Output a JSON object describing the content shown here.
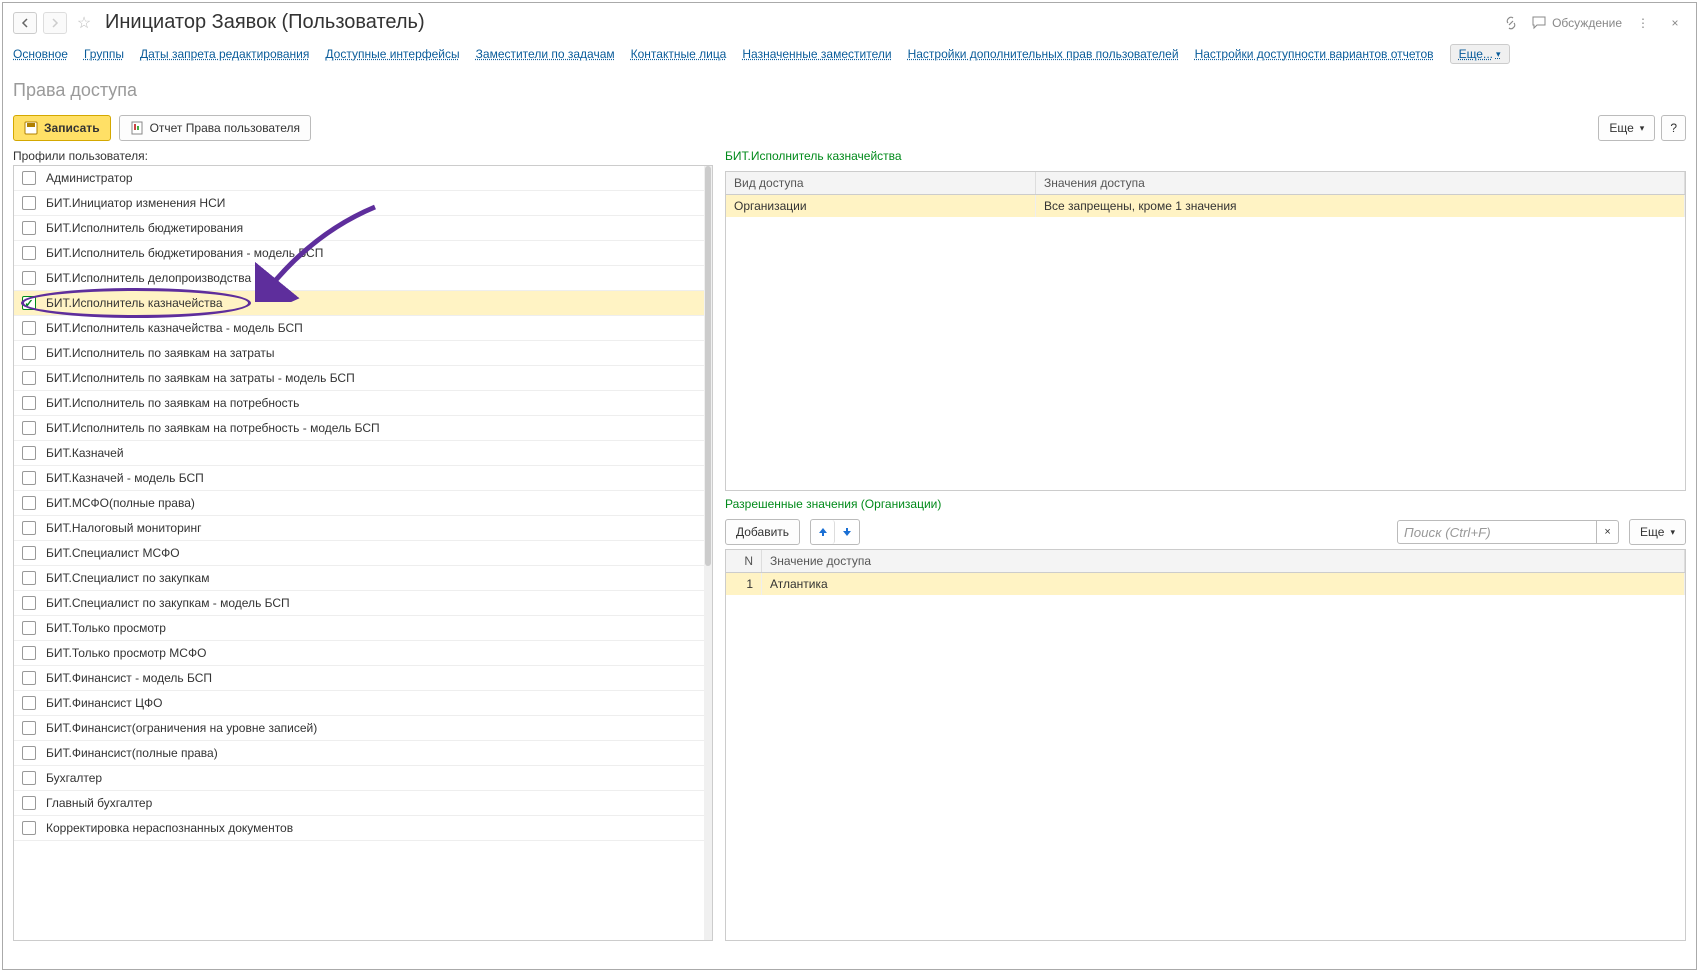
{
  "title": "Инициатор Заявок (Пользователь)",
  "discuss_label": "Обсуждение",
  "nav": {
    "items": [
      "Основное",
      "Группы",
      "Даты запрета редактирования",
      "Доступные интерфейсы",
      "Заместители по задачам",
      "Контактные лица",
      "Назначенные заместители",
      "Настройки дополнительных прав пользователей",
      "Настройки доступности вариантов отчетов"
    ],
    "more_label": "Еще..."
  },
  "page_title": "Права доступа",
  "toolbar": {
    "write_label": "Записать",
    "report_label": "Отчет Права пользователя",
    "more_label": "Еще",
    "help_label": "?"
  },
  "profiles": {
    "label": "Профили пользователя:",
    "items": [
      {
        "label": "Администратор",
        "checked": false
      },
      {
        "label": "БИТ.Инициатор изменения НСИ",
        "checked": false
      },
      {
        "label": "БИТ.Исполнитель бюджетирования",
        "checked": false
      },
      {
        "label": "БИТ.Исполнитель бюджетирования - модель БСП",
        "checked": false
      },
      {
        "label": "БИТ.Исполнитель делопроизводства",
        "checked": false
      },
      {
        "label": "БИТ.Исполнитель казначейства",
        "checked": true,
        "selected": true
      },
      {
        "label": "БИТ.Исполнитель казначейства - модель БСП",
        "checked": false
      },
      {
        "label": "БИТ.Исполнитель по заявкам на затраты",
        "checked": false
      },
      {
        "label": "БИТ.Исполнитель по заявкам на затраты - модель БСП",
        "checked": false
      },
      {
        "label": "БИТ.Исполнитель по заявкам на потребность",
        "checked": false
      },
      {
        "label": "БИТ.Исполнитель по заявкам на потребность - модель БСП",
        "checked": false
      },
      {
        "label": "БИТ.Казначей",
        "checked": false
      },
      {
        "label": "БИТ.Казначей - модель БСП",
        "checked": false
      },
      {
        "label": "БИТ.МСФО(полные права)",
        "checked": false
      },
      {
        "label": "БИТ.Налоговый мониторинг",
        "checked": false
      },
      {
        "label": "БИТ.Специалист МСФО",
        "checked": false
      },
      {
        "label": "БИТ.Специалист по закупкам",
        "checked": false
      },
      {
        "label": "БИТ.Специалист по закупкам - модель БСП",
        "checked": false
      },
      {
        "label": "БИТ.Только просмотр",
        "checked": false
      },
      {
        "label": "БИТ.Только просмотр МСФО",
        "checked": false
      },
      {
        "label": "БИТ.Финансист - модель БСП",
        "checked": false
      },
      {
        "label": "БИТ.Финансист ЦФО",
        "checked": false
      },
      {
        "label": "БИТ.Финансист(ограничения на уровне записей)",
        "checked": false
      },
      {
        "label": "БИТ.Финансист(полные права)",
        "checked": false
      },
      {
        "label": "Бухгалтер",
        "checked": false
      },
      {
        "label": "Главный бухгалтер",
        "checked": false
      },
      {
        "label": "Корректировка нераспознанных документов",
        "checked": false
      }
    ]
  },
  "access": {
    "title": "БИТ.Исполнитель казначейства",
    "col1": "Вид доступа",
    "col2": "Значения доступа",
    "rows": [
      {
        "kind": "Организации",
        "value": "Все запрещены, кроме 1 значения"
      }
    ]
  },
  "allowed": {
    "title": "Разрешенные значения (Организации)",
    "add_label": "Добавить",
    "search_placeholder": "Поиск (Ctrl+F)",
    "more_label": "Еще",
    "col0": "N",
    "col1": "Значение доступа",
    "rows": [
      {
        "n": "1",
        "value": "Атлантика"
      }
    ]
  }
}
